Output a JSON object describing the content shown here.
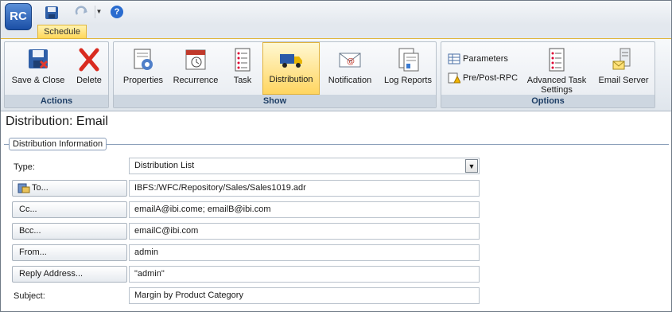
{
  "app": {
    "logo_text": "RC"
  },
  "quick_access": {
    "save_icon": "save-icon",
    "redo_icon": "redo-icon",
    "customize_icon": "chevron-down-icon",
    "help_icon": "help-icon",
    "help_glyph": "?"
  },
  "tabs": {
    "active_tab": "Schedule"
  },
  "ribbon": {
    "groups": {
      "actions": {
        "label": "Actions",
        "buttons": [
          {
            "label": "Save & Close",
            "icon": "save-close-icon"
          },
          {
            "label": "Delete",
            "icon": "delete-x-icon"
          }
        ]
      },
      "show": {
        "label": "Show",
        "buttons": [
          {
            "label": "Properties",
            "icon": "properties-icon"
          },
          {
            "label": "Recurrence",
            "icon": "calendar-icon"
          },
          {
            "label": "Task",
            "icon": "task-list-icon"
          },
          {
            "label": "Distribution",
            "icon": "truck-icon",
            "active": true
          },
          {
            "label": "Notification",
            "icon": "email-icon"
          },
          {
            "label": "Log Reports",
            "icon": "log-reports-icon"
          }
        ]
      },
      "options": {
        "label": "Options",
        "small_buttons": [
          {
            "label": "Parameters",
            "icon": "parameters-icon"
          },
          {
            "label": "Pre/Post-RPC",
            "icon": "pre-post-rpc-icon"
          }
        ],
        "buttons": [
          {
            "label": "Advanced Task Settings",
            "icon": "advanced-settings-icon"
          },
          {
            "label": "Email Server",
            "icon": "email-server-icon"
          }
        ]
      }
    }
  },
  "page": {
    "title": "Distribution: Email",
    "section_legend": "Distribution Information"
  },
  "form": {
    "type": {
      "label": "Type:",
      "value": "Distribution List"
    },
    "to": {
      "label": "To...",
      "value": "IBFS:/WFC/Repository/Sales/Sales1019.adr"
    },
    "cc": {
      "label": "Cc...",
      "value": "emailA@ibi.come; emailB@ibi.com"
    },
    "bcc": {
      "label": "Bcc...",
      "value": "emailC@ibi.com"
    },
    "from": {
      "label": "From...",
      "value": "admin"
    },
    "reply": {
      "label": "Reply Address...",
      "value": "\"admin\""
    },
    "subject": {
      "label": "Subject:",
      "value": "Margin by Product Category"
    }
  },
  "colors": {
    "accent_yellow": "#ffd560",
    "group_label_bg": "#cdd6e0",
    "group_label_text": "#1f3f66"
  }
}
